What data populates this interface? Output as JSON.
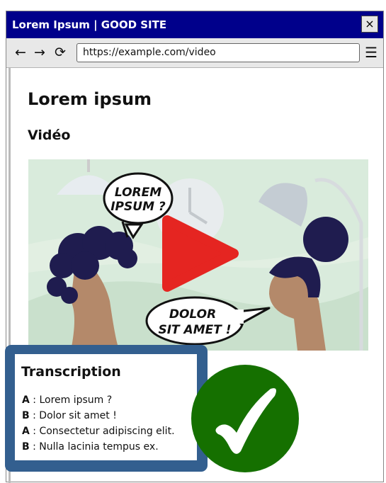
{
  "window": {
    "title": "Lorem Ipsum | GOOD SITE",
    "close_label": "×"
  },
  "navbar": {
    "back_label": "←",
    "forward_label": "→",
    "reload_label": "⟳",
    "url": "https://example.com/video",
    "menu_label": "☰"
  },
  "page": {
    "title": "Lorem ipsum",
    "section_title": "Vidéo"
  },
  "video": {
    "bubble_1_line_1": "LOREM",
    "bubble_1_line_2": "IPSUM ?",
    "bubble_2_line_1": "DOLOR",
    "bubble_2_line_2": "SIT AMET !",
    "play_color": "#e52521"
  },
  "transcription": {
    "title": "Transcription",
    "lines": [
      {
        "speaker": "A",
        "separator": " : ",
        "text": "Lorem ipsum ?"
      },
      {
        "speaker": "B",
        "separator": " : ",
        "text": "Dolor sit amet !"
      },
      {
        "speaker": "A",
        "separator": " : ",
        "text": "Consectetur adipiscing elit."
      },
      {
        "speaker": "B",
        "separator": " : ",
        "text": "Nulla lacinia tempus ex."
      }
    ]
  },
  "badge": {
    "icon": "checkmark-icon",
    "color": "#157000"
  }
}
